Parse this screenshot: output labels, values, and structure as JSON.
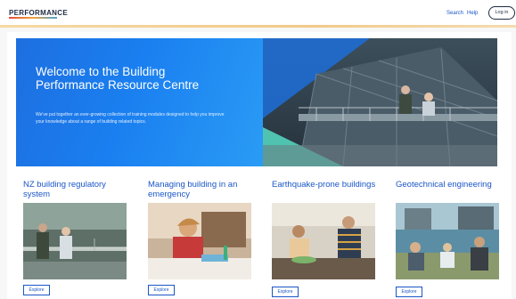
{
  "header": {
    "logo": "PERFORMANCE",
    "nav": {
      "search": "Search",
      "help": "Help"
    },
    "login": "Log in"
  },
  "hero": {
    "title": "Welcome to the Building Performance Resource Centre",
    "text": "We've put together an ever-growing collection of training modules designed to help you improve your knowledge about a range of building related topics."
  },
  "cards": [
    {
      "title": "NZ building regulatory system",
      "button": "Explore"
    },
    {
      "title": "Managing building in an emergency",
      "button": "Explore"
    },
    {
      "title": "Earthquake-prone buildings",
      "button": "Explore"
    },
    {
      "title": "Geotechnical engineering",
      "button": "Explore"
    }
  ],
  "colors": {
    "accent": "#1a56c7",
    "hero_blue": "#1e6fe0",
    "teal": "#4fc3b0"
  }
}
